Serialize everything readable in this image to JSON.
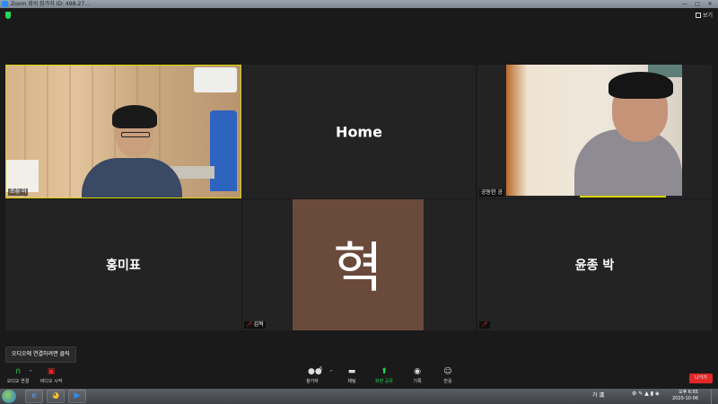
{
  "window": {
    "title": "Zoom 회의 참가자 ID: 498-27...",
    "minimize": "—",
    "maximize": "□",
    "close": "✕"
  },
  "topbar": {
    "view_label": "보기"
  },
  "tiles": [
    {
      "id": "tile-1",
      "type": "video",
      "name": "조성 이",
      "muted": false,
      "active": true
    },
    {
      "id": "tile-2",
      "type": "name",
      "display": "Home",
      "name": ""
    },
    {
      "id": "tile-3",
      "type": "video",
      "name": "공동한 공",
      "muted": false,
      "active": false
    },
    {
      "id": "tile-4",
      "type": "name",
      "display": "홍미표",
      "name": ""
    },
    {
      "id": "tile-5",
      "type": "avatar",
      "display": "혁",
      "name": "김혁",
      "muted": true
    },
    {
      "id": "tile-6",
      "type": "name",
      "display": "윤종 박",
      "name": "",
      "muted": true
    }
  ],
  "audio_tooltip": "오디오에 연결하려면 클릭",
  "toolbar": {
    "audio_label": "오디오 연결",
    "video_label": "비디오 시작",
    "participants_label": "참가자",
    "participants_count": "6",
    "chat_label": "채팅",
    "share_label": "화면 공유",
    "record_label": "기록",
    "reactions_label": "반응",
    "leave_label": "나가기"
  },
  "taskbar": {
    "ime": "가 漢",
    "clock_time": "오후 6:55",
    "clock_date": "2020-10-06"
  },
  "colors": {
    "accent_green": "#23d959",
    "leave_red": "#e02828",
    "active_speaker": "#d9d400",
    "avatar_bg": "#6a4a3b"
  }
}
